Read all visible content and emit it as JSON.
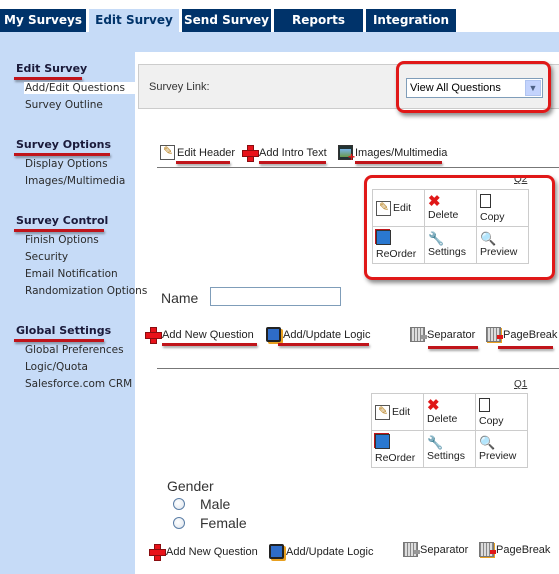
{
  "tabs": [
    {
      "label": "My Surveys",
      "active": false
    },
    {
      "label": "Edit Survey",
      "active": true
    },
    {
      "label": "Send Survey",
      "active": false
    },
    {
      "label": "Reports",
      "active": false
    },
    {
      "label": "Integration",
      "active": false
    }
  ],
  "sidebar": {
    "sections": [
      {
        "title": "Edit Survey",
        "items": [
          "Add/Edit Questions",
          "Survey Outline"
        ]
      },
      {
        "title": "Survey Options",
        "items": [
          "Display Options",
          "Images/Multimedia"
        ]
      },
      {
        "title": "Survey Control",
        "items": [
          "Finish Options",
          "Security",
          "Email Notification",
          "Randomization Options"
        ]
      },
      {
        "title": "Global Settings",
        "items": [
          "Global Preferences",
          "Logic/Quota",
          "Salesforce.com CRM"
        ]
      }
    ],
    "active_item": "Add/Edit Questions"
  },
  "survey_link": {
    "label": "Survey Link:",
    "select_value": "View All Questions"
  },
  "header_toolbar": {
    "edit_header": "Edit Header",
    "add_intro_text": "Add Intro Text",
    "images_multimedia": "Images/Multimedia"
  },
  "question_actions": {
    "edit": "Edit",
    "delete": "Delete",
    "copy": "Copy",
    "reorder": "ReOrder",
    "settings": "Settings",
    "preview": "Preview"
  },
  "questions": [
    {
      "number": "Q2",
      "label": "Name",
      "type": "text",
      "value": ""
    },
    {
      "number": "Q1",
      "label": "Gender",
      "type": "radio",
      "options": [
        "Male",
        "Female"
      ]
    }
  ],
  "question_toolbar": {
    "add_new_question": "Add New Question",
    "add_update_logic": "Add/Update Logic",
    "separator": "Separator",
    "page_break": "PageBreak"
  },
  "colors": {
    "tab_bg": "#00336a",
    "tab_active_bg": "#c6dbf7",
    "annotation_red": "#e01818"
  }
}
